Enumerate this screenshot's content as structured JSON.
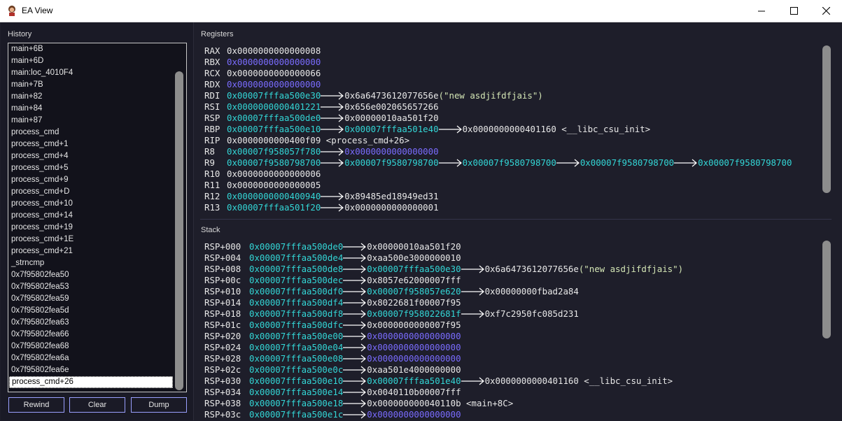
{
  "window": {
    "title": "EA View"
  },
  "history": {
    "label": "History",
    "items": [
      "main+6B",
      "main+6D",
      "main:loc_4010F4",
      "main+7B",
      "main+82",
      "main+84",
      "main+87",
      "process_cmd",
      "process_cmd+1",
      "process_cmd+4",
      "process_cmd+5",
      "process_cmd+9",
      "process_cmd+D",
      "process_cmd+10",
      "process_cmd+14",
      "process_cmd+19",
      "process_cmd+1E",
      "process_cmd+21",
      "_strncmp",
      "0x7f95802fea50",
      "0x7f95802fea53",
      "0x7f95802fea59",
      "0x7f95802fea5d",
      "0x7f95802fea63",
      "0x7f95802fea66",
      "0x7f95802fea68",
      "0x7f95802fea6a",
      "0x7f95802fea6e",
      "process_cmd+26"
    ],
    "selected_index": 28
  },
  "buttons": {
    "rewind": "Rewind",
    "clear": "Clear",
    "dump": "Dump"
  },
  "registers": {
    "label": "Registers",
    "rows": [
      {
        "name": "RAX",
        "chain": [
          {
            "t": "0x0000000000000008",
            "c": "white"
          }
        ]
      },
      {
        "name": "RBX",
        "chain": [
          {
            "t": "0x0000000000000000",
            "c": "blue"
          }
        ]
      },
      {
        "name": "RCX",
        "chain": [
          {
            "t": "0x0000000000000066",
            "c": "white"
          }
        ]
      },
      {
        "name": "RDX",
        "chain": [
          {
            "t": "0x0000000000000000",
            "c": "blue"
          }
        ]
      },
      {
        "name": "RDI",
        "chain": [
          {
            "t": "0x00007fffaa500e30",
            "c": "cyan"
          },
          {
            "t": "0x6a6473612077656e",
            "c": "white",
            "str": "(\"new asdjifdfjais\")"
          }
        ]
      },
      {
        "name": "RSI",
        "chain": [
          {
            "t": "0x0000000000401221",
            "c": "cyan"
          },
          {
            "t": "0x656e002065657266",
            "c": "white"
          }
        ]
      },
      {
        "name": "RSP",
        "chain": [
          {
            "t": "0x00007fffaa500de0",
            "c": "cyan"
          },
          {
            "t": "0x00000010aa501f20",
            "c": "white"
          }
        ]
      },
      {
        "name": "RBP",
        "chain": [
          {
            "t": "0x00007fffaa500e10",
            "c": "cyan"
          },
          {
            "t": "0x00007fffaa501e40",
            "c": "cyan"
          },
          {
            "t": "0x0000000000401160",
            "c": "white",
            "sym": " <__libc_csu_init>"
          }
        ]
      },
      {
        "name": "RIP",
        "chain": [
          {
            "t": "0x0000000000400f09",
            "c": "white",
            "sym": " <process_cmd+26>"
          }
        ]
      },
      {
        "name": "R8",
        "chain": [
          {
            "t": "0x00007f958057f780",
            "c": "cyan"
          },
          {
            "t": "0x0000000000000000",
            "c": "blue"
          }
        ]
      },
      {
        "name": "R9",
        "chain": [
          {
            "t": "0x00007f9580798700",
            "c": "cyan"
          },
          {
            "t": "0x00007f9580798700",
            "c": "cyan"
          },
          {
            "t": "0x00007f9580798700",
            "c": "cyan"
          },
          {
            "t": "0x00007f9580798700",
            "c": "cyan"
          },
          {
            "t": "0x00007f9580798700",
            "c": "cyan"
          }
        ]
      },
      {
        "name": "R10",
        "chain": [
          {
            "t": "0x0000000000000006",
            "c": "white"
          }
        ]
      },
      {
        "name": "R11",
        "chain": [
          {
            "t": "0x0000000000000005",
            "c": "white"
          }
        ]
      },
      {
        "name": "R12",
        "chain": [
          {
            "t": "0x0000000000400940",
            "c": "cyan"
          },
          {
            "t": "0x89485ed18949ed31",
            "c": "white"
          }
        ]
      },
      {
        "name": "R13",
        "chain": [
          {
            "t": "0x00007fffaa501f20",
            "c": "cyan"
          },
          {
            "t": "0x0000000000000001",
            "c": "white"
          }
        ]
      }
    ]
  },
  "stack": {
    "label": "Stack",
    "rows": [
      {
        "name": "RSP+000",
        "chain": [
          {
            "t": "0x00007fffaa500de0",
            "c": "cyan"
          },
          {
            "t": "0x00000010aa501f20",
            "c": "white"
          }
        ]
      },
      {
        "name": "RSP+004",
        "chain": [
          {
            "t": "0x00007fffaa500de4",
            "c": "cyan"
          },
          {
            "t": "0xaa500e3000000010",
            "c": "white"
          }
        ]
      },
      {
        "name": "RSP+008",
        "chain": [
          {
            "t": "0x00007fffaa500de8",
            "c": "cyan"
          },
          {
            "t": "0x00007fffaa500e30",
            "c": "cyan"
          },
          {
            "t": "0x6a6473612077656e",
            "c": "white",
            "str": "(\"new asdjifdfjais\")"
          }
        ]
      },
      {
        "name": "RSP+00c",
        "chain": [
          {
            "t": "0x00007fffaa500dec",
            "c": "cyan"
          },
          {
            "t": "0x8057e62000007fff",
            "c": "white"
          }
        ]
      },
      {
        "name": "RSP+010",
        "chain": [
          {
            "t": "0x00007fffaa500df0",
            "c": "cyan"
          },
          {
            "t": "0x00007f958057e620",
            "c": "cyan"
          },
          {
            "t": "0x00000000fbad2a84",
            "c": "white"
          }
        ]
      },
      {
        "name": "RSP+014",
        "chain": [
          {
            "t": "0x00007fffaa500df4",
            "c": "cyan"
          },
          {
            "t": "0x8022681f00007f95",
            "c": "white"
          }
        ]
      },
      {
        "name": "RSP+018",
        "chain": [
          {
            "t": "0x00007fffaa500df8",
            "c": "cyan"
          },
          {
            "t": "0x00007f958022681f",
            "c": "cyan"
          },
          {
            "t": "0xf7c2950fc085d231",
            "c": "white"
          }
        ]
      },
      {
        "name": "RSP+01c",
        "chain": [
          {
            "t": "0x00007fffaa500dfc",
            "c": "cyan"
          },
          {
            "t": "0x0000000000007f95",
            "c": "white"
          }
        ]
      },
      {
        "name": "RSP+020",
        "chain": [
          {
            "t": "0x00007fffaa500e00",
            "c": "cyan"
          },
          {
            "t": "0x0000000000000000",
            "c": "blue"
          }
        ]
      },
      {
        "name": "RSP+024",
        "chain": [
          {
            "t": "0x00007fffaa500e04",
            "c": "cyan"
          },
          {
            "t": "0x0000000000000000",
            "c": "blue"
          }
        ]
      },
      {
        "name": "RSP+028",
        "chain": [
          {
            "t": "0x00007fffaa500e08",
            "c": "cyan"
          },
          {
            "t": "0x0000000000000000",
            "c": "blue"
          }
        ]
      },
      {
        "name": "RSP+02c",
        "chain": [
          {
            "t": "0x00007fffaa500e0c",
            "c": "cyan"
          },
          {
            "t": "0xaa501e4000000000",
            "c": "white"
          }
        ]
      },
      {
        "name": "RSP+030",
        "chain": [
          {
            "t": "0x00007fffaa500e10",
            "c": "cyan"
          },
          {
            "t": "0x00007fffaa501e40",
            "c": "cyan"
          },
          {
            "t": "0x0000000000401160",
            "c": "white",
            "sym": " <__libc_csu_init>"
          }
        ]
      },
      {
        "name": "RSP+034",
        "chain": [
          {
            "t": "0x00007fffaa500e14",
            "c": "cyan"
          },
          {
            "t": "0x0040110b00007fff",
            "c": "white"
          }
        ]
      },
      {
        "name": "RSP+038",
        "chain": [
          {
            "t": "0x00007fffaa500e18",
            "c": "cyan"
          },
          {
            "t": "0x000000000040110b",
            "c": "white",
            "sym": " <main+8C>"
          }
        ]
      },
      {
        "name": "RSP+03c",
        "chain": [
          {
            "t": "0x00007fffaa500e1c",
            "c": "cyan"
          },
          {
            "t": "0x0000000000000000",
            "c": "blue"
          }
        ]
      }
    ]
  },
  "colors": {
    "cyan": "#33d6d6",
    "blue": "#7a6cff",
    "white": "#e8e8e8",
    "string": "#d4e6b5",
    "accent": "#9aa0ff"
  }
}
